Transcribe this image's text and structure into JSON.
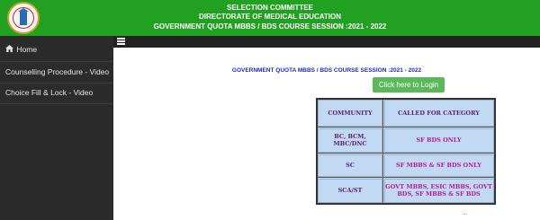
{
  "header": {
    "line1": "SELECTION COMMITTEE",
    "line2": "DIRECTORATE OF MEDICAL EDUCATION",
    "line3": "GOVERNMENT QUOTA MBBS / BDS COURSE SESSION :2021 - 2022",
    "colors": {
      "background": "#22a022",
      "text": "#ffffff"
    }
  },
  "sidebar": {
    "items": [
      {
        "label": "Home",
        "icon": "home-icon"
      },
      {
        "label": "Counselling Procedure - Video"
      },
      {
        "label": "Choice Fill & Lock - Video"
      }
    ]
  },
  "topbar": {
    "icon": "menu-icon"
  },
  "main": {
    "session_title": "GOVERNMENT QUOTA MBBS / BDS COURSE SESSION :2021 - 2022",
    "login_button": "Click here to Login",
    "table": {
      "headers": [
        "COMMUNITY",
        "CALLED FOR CATEGORY"
      ],
      "rows": [
        {
          "community": "BC, BCM, MBC/DNC",
          "called": "SF BDS ONLY"
        },
        {
          "community": "SC",
          "called": "SF MBBS & SF BDS ONLY"
        },
        {
          "community": "SCA/ST",
          "called": "GOVT MBBS, ESIC MBBS, GOVT BDS, SF MBBS & SF BDS"
        }
      ]
    },
    "footer_text": "..."
  }
}
